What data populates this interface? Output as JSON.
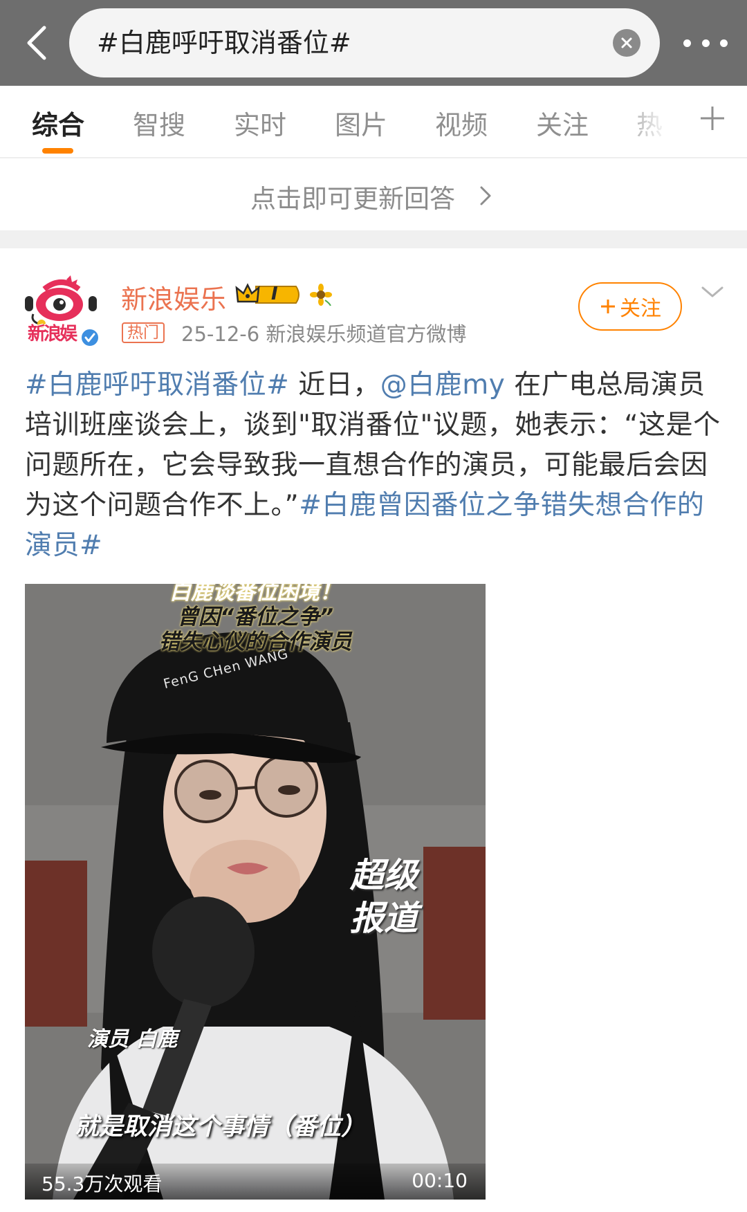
{
  "search": {
    "query": "#白鹿呼吁取消番位#"
  },
  "tabs": [
    {
      "label": "综合",
      "active": true
    },
    {
      "label": "智搜"
    },
    {
      "label": "实时"
    },
    {
      "label": "图片"
    },
    {
      "label": "视频"
    },
    {
      "label": "关注"
    },
    {
      "label": "热"
    }
  ],
  "refresh": {
    "label": "点击即可更新回答"
  },
  "post": {
    "author": {
      "name": "新浪娱乐",
      "avatar_text": "新浪娱",
      "vip_level": "I"
    },
    "hot_tag": "热门",
    "meta": "25-12-6  新浪娱乐频道官方微博",
    "follow_label": "关注",
    "text": {
      "topic1": "#白鹿呼吁取消番位#",
      "part1": " 近日，",
      "mention": "@白鹿my",
      "part2": " 在广电总局演员培训班座谈会上，谈到\"取消番位\"议题，她表示：“这是个问题所在，它会导致我一直想合作的演员，可能最后会因为这个问题合作不上。”",
      "topic2": "#白鹿曾因番位之争错失想合作的演员#"
    },
    "video": {
      "caption_line1": "白鹿谈番位困境！",
      "caption_line2": "曾因“番位之争”",
      "caption_line3": "错失心仪的合作演员",
      "cap_text": "FenG CHen WANG",
      "brand_line1": "超级",
      "brand_line2": "报道",
      "speaker": "演员  白鹿",
      "subtitle": "就是取消这个事情（番位）",
      "views": "55.3万次观看",
      "duration": "00:10",
      "bottom_watermark": "超级报道"
    }
  },
  "colors": {
    "accent_orange": "#ff8200",
    "author_orange": "#eb7350",
    "link_blue": "#507daf",
    "topbar_gray": "#6e6e6e"
  }
}
